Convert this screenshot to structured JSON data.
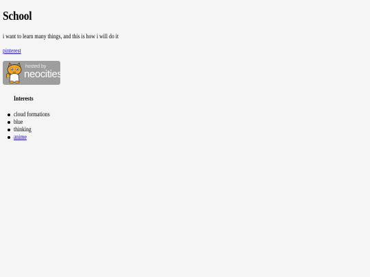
{
  "page": {
    "title": "School",
    "intro": "i want to learn many things, and this is how i will do it",
    "pinterest_link": "pinterest"
  },
  "badge": {
    "hosted_text": "hosted by",
    "brand_text": "neocities",
    "icon": "neocities-cat-icon",
    "colors": {
      "background": "#9e9e9e",
      "cat_orange": "#f5a623"
    }
  },
  "interests": {
    "heading": "Interests",
    "items": [
      {
        "label": "cloud formations",
        "is_link": false
      },
      {
        "label": "blue",
        "is_link": false
      },
      {
        "label": "thinking",
        "is_link": false
      },
      {
        "label": "anime",
        "is_link": true
      }
    ]
  },
  "colors": {
    "page_background": "#f5f5f5",
    "link": "#1a0dab"
  }
}
